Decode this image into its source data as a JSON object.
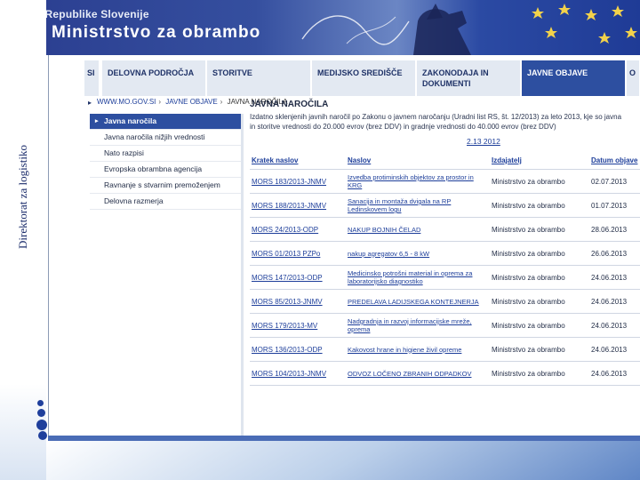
{
  "banner": {
    "government": "Vlada Republike Slovenije",
    "ministry": "Ministrstvo za obrambo"
  },
  "side": {
    "title": "Direktorat za logistiko"
  },
  "nav": {
    "tabs": [
      {
        "label": "SI"
      },
      {
        "label": "DELOVNA PODROČJA"
      },
      {
        "label": "STORITVE"
      },
      {
        "label": "MEDIJSKO SREDIŠČE"
      },
      {
        "label": "ZAKONODAJA IN DOKUMENTI"
      },
      {
        "label": "JAVNE OBJAVE"
      },
      {
        "label": "O"
      }
    ]
  },
  "breadcrumb": {
    "items": [
      "WWW.MO.GOV.SI",
      "JAVNE OBJAVE",
      "JAVNA NAROČILA"
    ]
  },
  "menu": {
    "items": [
      {
        "label": "Javna naročila"
      },
      {
        "label": "Javna naročila nižjih vrednosti"
      },
      {
        "label": "Nato razpisi"
      },
      {
        "label": "Evropska obrambna agencija"
      },
      {
        "label": "Ravnanje s stvarnim premoženjem"
      },
      {
        "label": "Delovna razmerja"
      }
    ]
  },
  "content": {
    "title": "JAVNA NAROČILA",
    "desc_line1": "Izdatno sklenjenih javnih naročil po Zakonu o javnem naročanju (Uradni list RS, št. 12/2013) za leto 2013, kje so javna",
    "desc_line2": "in storitve vrednosti do 20.000 evrov (brez DDV) in gradnje vrednosti do 40.000 evrov (brez DDV)",
    "date_range": "2.13 2012"
  },
  "table": {
    "headers": {
      "title": "Kratek naslov",
      "subject": "Naslov",
      "issuer": "Izdajatelj",
      "date": "Datum objave"
    },
    "rows": [
      {
        "code": "MORS 183/2013-JNMV",
        "subject": "Izvedba protiminskih objektov za prostor in KRG",
        "issuer": "Ministrstvo za obrambo",
        "date": "02.07.2013"
      },
      {
        "code": "MORS 188/2013-JNMV",
        "subject": "Sanacija in montaža dvigala na RP Ledinskovem logu",
        "issuer": "Ministrstvo za obrambo",
        "date": "01.07.2013"
      },
      {
        "code": "MORS 24/2013-ODP",
        "subject": "NAKUP BOJNIH ČELAD",
        "issuer": "Ministrstvo za obrambo",
        "date": "28.06.2013"
      },
      {
        "code": "MORS 01/2013 PZPo",
        "subject": "nakup agregatov 6,5 - 8 kW",
        "issuer": "Ministrstvo za obrambo",
        "date": "26.06.2013"
      },
      {
        "code": "MORS 147/2013-ODP",
        "subject": "Medicinsko potrošni material in oprema za laboratorijsko diagnostiko",
        "issuer": "Ministrstvo za obrambo",
        "date": "24.06.2013"
      },
      {
        "code": "MORS 85/2013-JNMV",
        "subject": "PREDELAVA LADIJSKEGA KONTEJNERJA",
        "issuer": "Ministrstvo za obrambo",
        "date": "24.06.2013"
      },
      {
        "code": "MORS 179/2013-MV",
        "subject": "Nadgradnja in razvoj informacijske mreže, oprema",
        "issuer": "Ministrstvo za obrambo",
        "date": "24.06.2013"
      },
      {
        "code": "MORS 136/2013-ODP",
        "subject": "Kakovost hrane in higiene živil opreme",
        "issuer": "Ministrstvo za obrambo",
        "date": "24.06.2013"
      },
      {
        "code": "MORS 104/2013-JNMV",
        "subject": "ODVOZ LOČENO ZBRANIH ODPADKOV",
        "issuer": "Ministrstvo za obrambo",
        "date": "24.06.2013"
      }
    ]
  },
  "colors": {
    "brand": "#2d4fa0",
    "link": "#1d3e9a"
  }
}
